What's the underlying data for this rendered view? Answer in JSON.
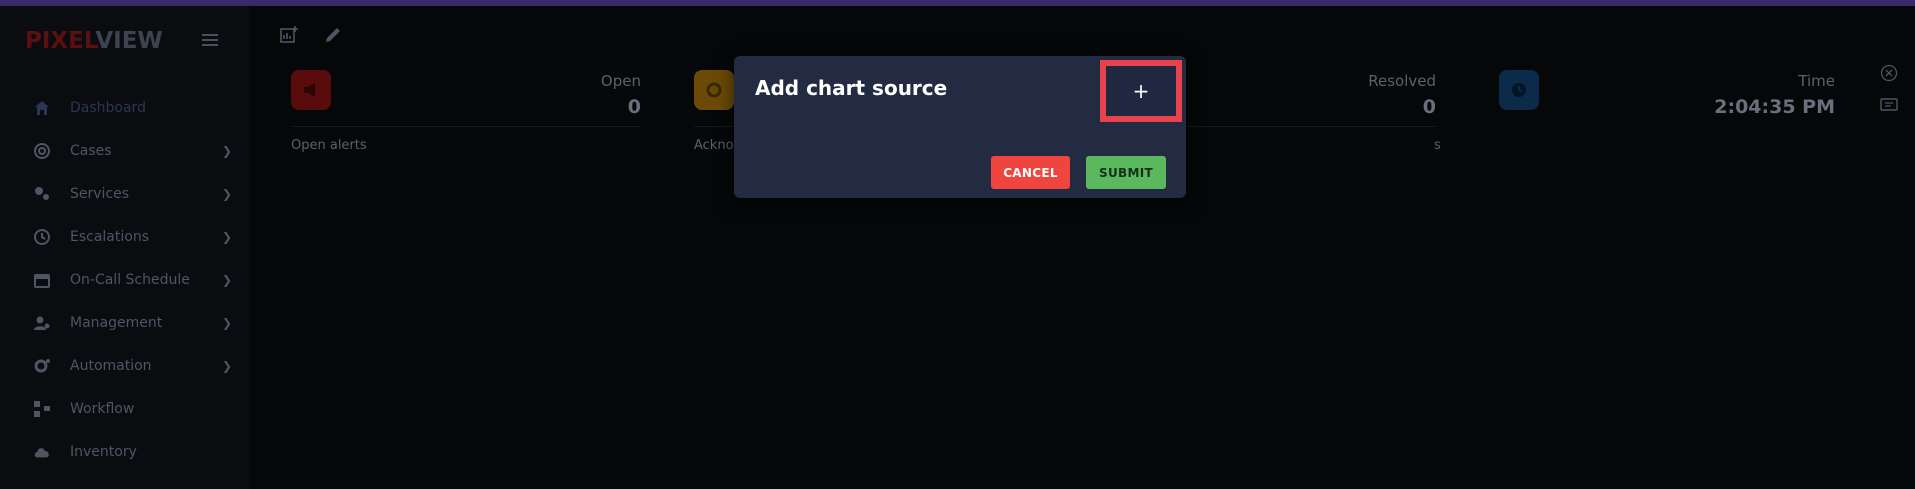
{
  "brand": {
    "part1": "PIXEL",
    "part2": "VIEW"
  },
  "sidebar": {
    "items": [
      {
        "label": "Dashboard",
        "icon": "home-icon",
        "has_chevron": false
      },
      {
        "label": "Cases",
        "icon": "cases-icon",
        "has_chevron": true
      },
      {
        "label": "Services",
        "icon": "services-icon",
        "has_chevron": true
      },
      {
        "label": "Escalations",
        "icon": "escalations-icon",
        "has_chevron": true
      },
      {
        "label": "On-Call Schedule",
        "icon": "calendar-icon",
        "has_chevron": true
      },
      {
        "label": "Management",
        "icon": "management-icon",
        "has_chevron": true
      },
      {
        "label": "Automation",
        "icon": "automation-icon",
        "has_chevron": true
      },
      {
        "label": "Workflow",
        "icon": "workflow-icon",
        "has_chevron": false
      },
      {
        "label": "Inventory",
        "icon": "cloud-icon",
        "has_chevron": false
      }
    ]
  },
  "cards": {
    "open": {
      "title": "Open",
      "value": "0",
      "footer": "Open alerts",
      "color": "#5a0c0c"
    },
    "ack": {
      "title": "",
      "value": "",
      "footer": "Ackno",
      "color": "#6b4a07"
    },
    "resolved": {
      "title": "Resolved",
      "value": "0",
      "footer": "s",
      "color": "#0c2a4a"
    },
    "time": {
      "title": "Time",
      "value": "2:04:35 PM",
      "footer": "",
      "color": "#0c2a4a"
    }
  },
  "modal": {
    "title": "Add chart source",
    "add_label": "+",
    "cancel_label": "CANCEL",
    "submit_label": "SUBMIT"
  },
  "colors": {
    "accent_purple": "#3a2a6b",
    "modal_bg": "#222b42",
    "cancel": "#f0453f",
    "submit": "#5cb85c",
    "highlight": "#e8434d"
  }
}
